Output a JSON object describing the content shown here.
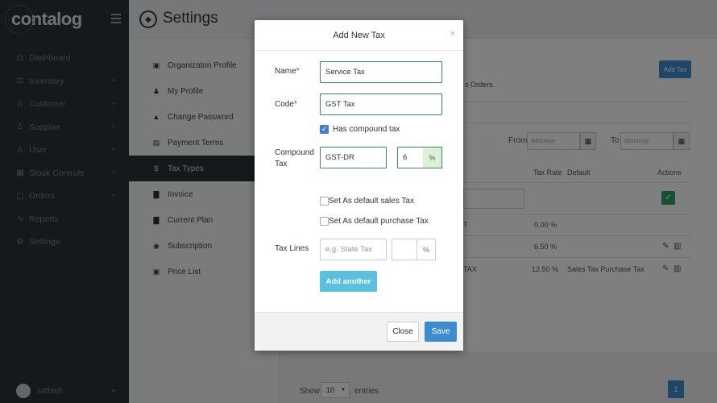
{
  "brand": "contalog",
  "header": {
    "title": "Settings"
  },
  "sidebar": {
    "items": [
      {
        "label": "Dashboard",
        "icon": "⛭",
        "plus": ""
      },
      {
        "label": "Inventory",
        "icon": "⚖",
        "plus": "+"
      },
      {
        "label": "Customer",
        "icon": "♙",
        "plus": "+"
      },
      {
        "label": "Supplier",
        "icon": "♙",
        "plus": "+"
      },
      {
        "label": "User",
        "icon": "♙",
        "plus": "+"
      },
      {
        "label": "Stock Controls",
        "icon": "▦",
        "plus": "+"
      },
      {
        "label": "Orders",
        "icon": "▢",
        "plus": "+"
      },
      {
        "label": "Reports",
        "icon": "∿",
        "plus": ""
      },
      {
        "label": "Settings",
        "icon": "⚙",
        "plus": ""
      }
    ],
    "user": {
      "name": "sathish",
      "plus": "+"
    }
  },
  "settings_nav": [
    {
      "label": "Organizaton Profile",
      "icon": "▣"
    },
    {
      "label": "My Profile",
      "icon": "♟"
    },
    {
      "label": "Change Password",
      "icon": "▲"
    },
    {
      "label": "Payment Terms",
      "icon": "▤"
    },
    {
      "label": "Tax Types",
      "icon": "$"
    },
    {
      "label": "Invoice",
      "icon": "▇"
    },
    {
      "label": "Current Plan",
      "icon": "▇"
    },
    {
      "label": "Subscription",
      "icon": "◉"
    },
    {
      "label": "Price List",
      "icon": "▣"
    }
  ],
  "background": {
    "add_tax_label": "Add Tax",
    "orders_text": "s Orders.",
    "from_label": "From",
    "to_label": "To",
    "date_placeholder": "dd/mm/yy",
    "col_tax_rate": "Tax Rate",
    "col_default": "Default",
    "col_actions": "Actions",
    "rows": [
      {
        "name": "T",
        "rate": "0.00 %",
        "default": ""
      },
      {
        "name": "",
        "rate": "6.50 %",
        "default": ""
      },
      {
        "name": "TAX",
        "rate": "12.50 %",
        "default": "Sales Tax Purchase Tax"
      }
    ],
    "show_label": "Show",
    "show_value": "10",
    "entries_label": "entries",
    "page_number": "1"
  },
  "modal": {
    "title": "Add New Tax",
    "close_symbol": "×",
    "name_label": "Name",
    "name_value": "Service Tax",
    "code_label": "Code",
    "code_value": "GST Tax",
    "compound_checkbox_label": "Has compound tax",
    "compound_label": "Compound Tax",
    "compound_value": "GST-DR",
    "compound_rate": "6",
    "percent": "%",
    "default_sales_label": "Set As default sales Tax",
    "default_purchase_label": "Set As default purchase Tax",
    "tax_lines_label": "Tax Lines",
    "tax_line_placeholder": "e.g. State Tax",
    "add_another_label": "Add another",
    "close_label": "Close",
    "save_label": "Save"
  }
}
